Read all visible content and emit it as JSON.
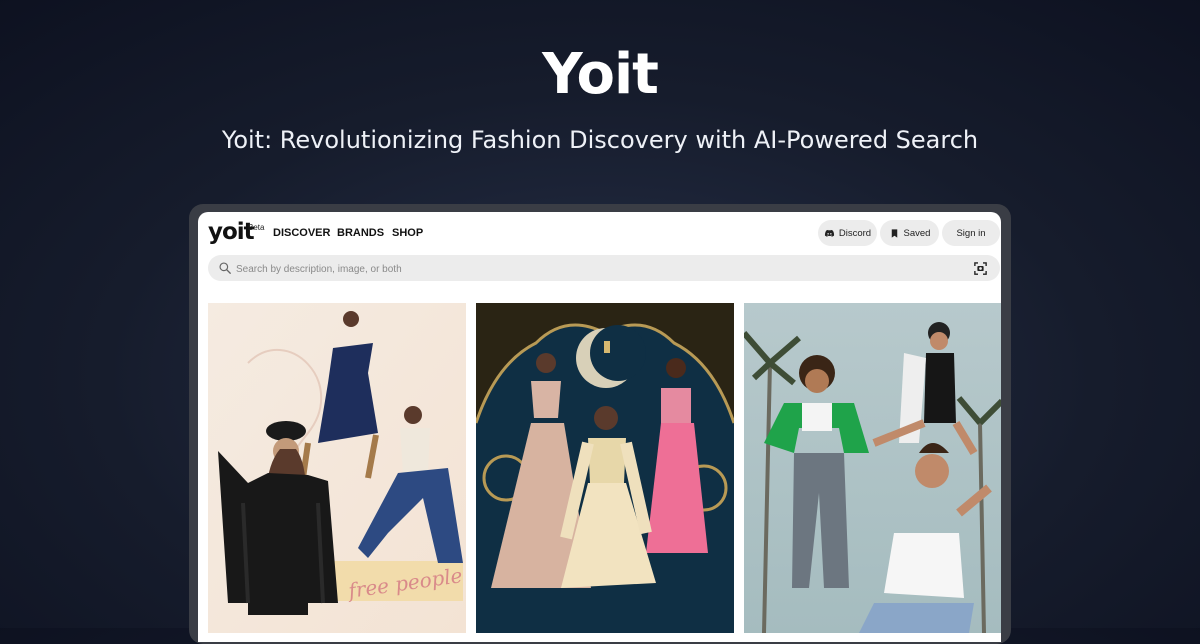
{
  "hero": {
    "title": "Yoit",
    "subtitle": "Yoit: Revolutionizing Fashion Discovery with AI-Powered Search"
  },
  "app": {
    "logo": "yoit",
    "badge": "Beta",
    "nav": [
      {
        "label": "DISCOVER"
      },
      {
        "label": "BRANDS"
      },
      {
        "label": "SHOP"
      }
    ],
    "buttons": {
      "discord": "Discord",
      "saved": "Saved",
      "signin": "Sign in"
    },
    "search": {
      "placeholder": "Search by description, image, or both",
      "value": ""
    },
    "grid": [
      {
        "icon": "fashion-collage-boho-image",
        "caption": "free people"
      },
      {
        "icon": "fashion-collage-festive-image"
      },
      {
        "icon": "fashion-collage-streetwear-image"
      }
    ]
  },
  "colors": {
    "background": "#161c2c",
    "frame": "#3a3d45",
    "pill": "#ececec",
    "text": "#111111"
  }
}
